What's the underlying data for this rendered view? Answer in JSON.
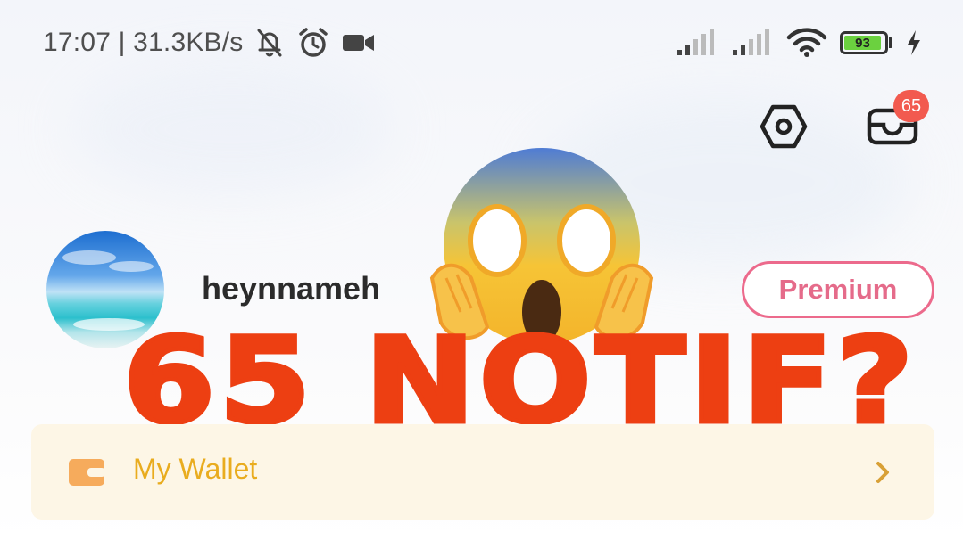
{
  "status_bar": {
    "time_speed": "17:07 | 31.3KB/s",
    "battery_level": "93",
    "icons": [
      "bell-muted-icon",
      "alarm-icon",
      "video-icon",
      "signal-icon",
      "signal-icon",
      "wifi-icon",
      "battery-icon",
      "charging-icon"
    ]
  },
  "header": {
    "notification_count": "65",
    "icons": [
      "settings-icon",
      "mail-icon"
    ]
  },
  "profile": {
    "username": "heynnameh",
    "premium_label": "Premium"
  },
  "overlay": {
    "caption": "65 NOTIF?",
    "color": "#ed3f12"
  },
  "wallet": {
    "label": "My Wallet",
    "color": "#e9ac1e"
  },
  "colors": {
    "badge": "#f25a4f",
    "premium": "#e56b8a",
    "battery_fill": "#6bd13f"
  }
}
